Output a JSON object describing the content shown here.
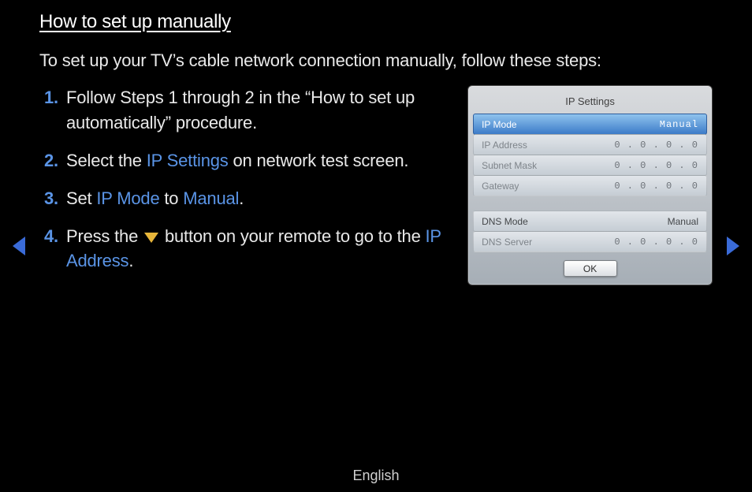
{
  "title": "How to set up manually",
  "intro": "To set up your TV’s cable network connection manually, follow these steps:",
  "steps": {
    "s1": "Follow Steps 1 through 2 in the “How to set up automatically” procedure.",
    "s2_a": "Select the ",
    "s2_kw": "IP Settings",
    "s2_b": " on network test screen.",
    "s3_a": "Set ",
    "s3_k1": "IP Mode",
    "s3_b": " to ",
    "s3_k2": "Manual",
    "s3_c": ".",
    "s4_a": "Press the ",
    "s4_b": " button on your remote to go to the ",
    "s4_k": "IP Address",
    "s4_c": "."
  },
  "panel": {
    "title": "IP Settings",
    "ip_mode_label": "IP Mode",
    "ip_mode_value": "Manual",
    "rows1": [
      {
        "label": "IP Address",
        "value": "0 . 0 . 0 . 0"
      },
      {
        "label": "Subnet Mask",
        "value": "0 . 0 . 0 . 0"
      },
      {
        "label": "Gateway",
        "value": "0 . 0 . 0 . 0"
      }
    ],
    "dns_mode_label": "DNS Mode",
    "dns_mode_value": "Manual",
    "rows2": [
      {
        "label": "DNS Server",
        "value": "0 . 0 . 0 . 0"
      }
    ],
    "ok": "OK"
  },
  "footer": "English"
}
